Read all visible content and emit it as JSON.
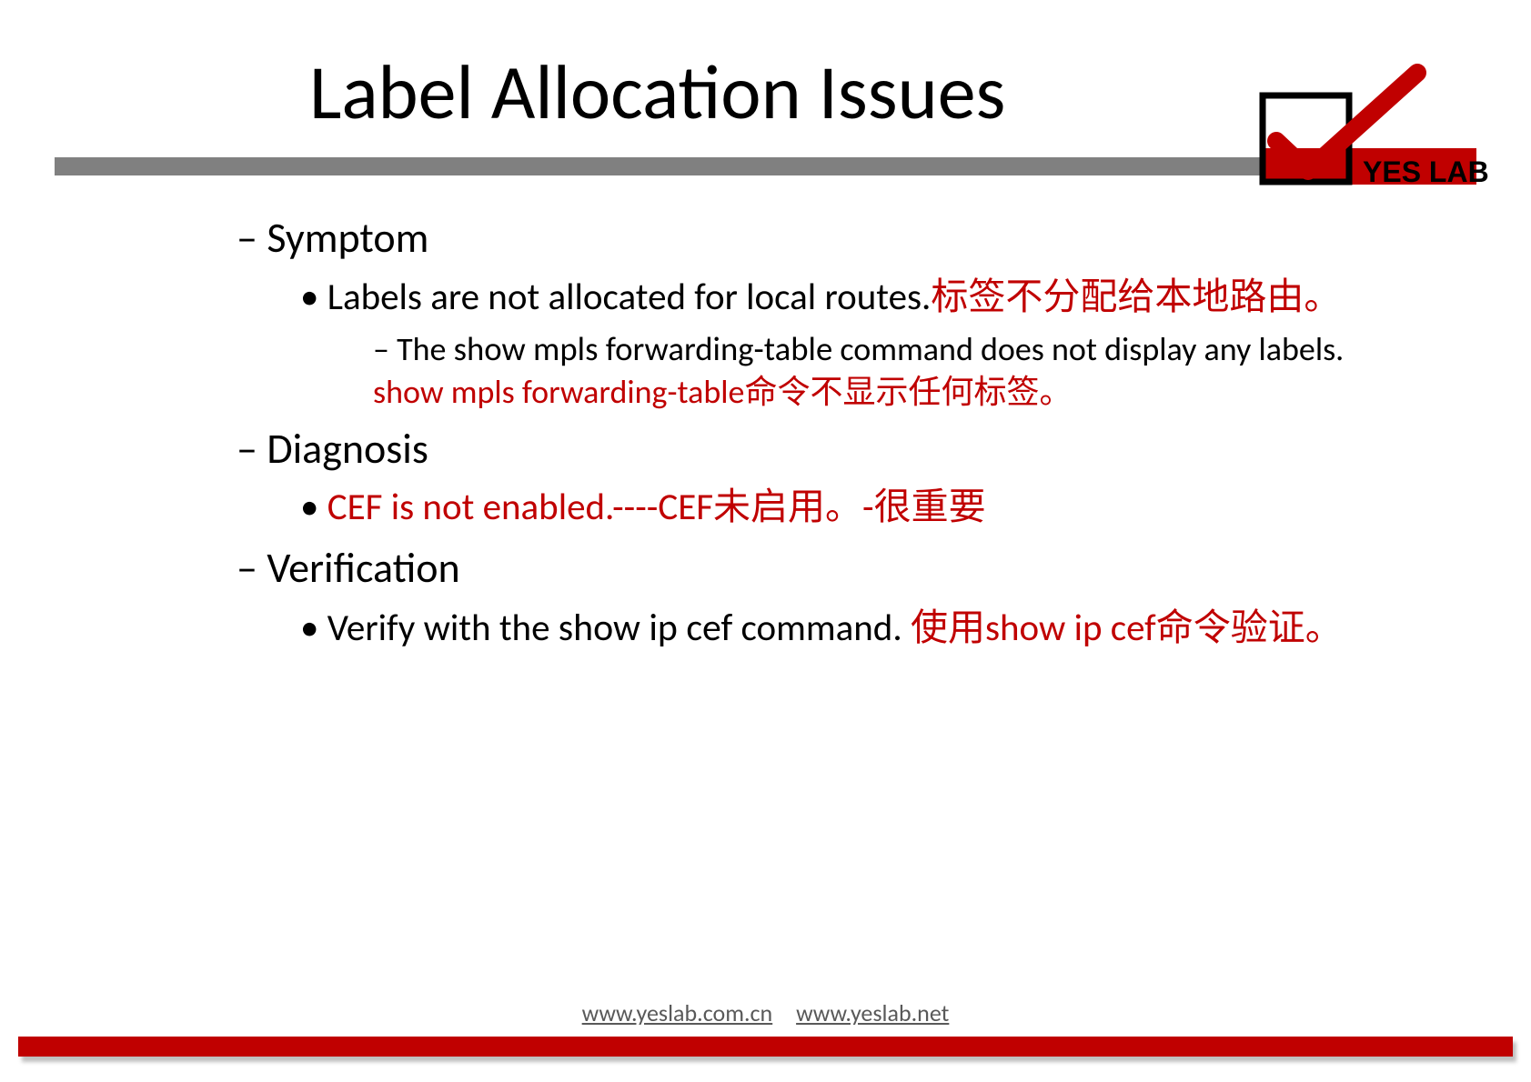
{
  "title": "Label Allocation Issues",
  "logo_text": "YES LAB",
  "sections": {
    "symptom": {
      "heading": "Symptom",
      "bullet_en": "Labels are not allocated for local routes.",
      "bullet_zh": "标签不分配给本地路由。",
      "sub_en_pre": "The ",
      "sub_cmd": "show mpls forwarding-table",
      "sub_en_post": " command does not display any labels. ",
      "sub_zh": "show mpls forwarding-table命令不显示任何标签。"
    },
    "diagnosis": {
      "heading": "Diagnosis",
      "bullet": "CEF is not enabled.----CEF未启用。-很重要"
    },
    "verification": {
      "heading": "Verification",
      "bullet_en_pre": "Verify with the ",
      "bullet_cmd": "show ip cef",
      "bullet_en_post": " command.  ",
      "bullet_zh": "使用show ip cef命令验证。"
    }
  },
  "footer": {
    "link1": "www.yeslab.com.cn",
    "link2": "www.yeslab.net"
  }
}
